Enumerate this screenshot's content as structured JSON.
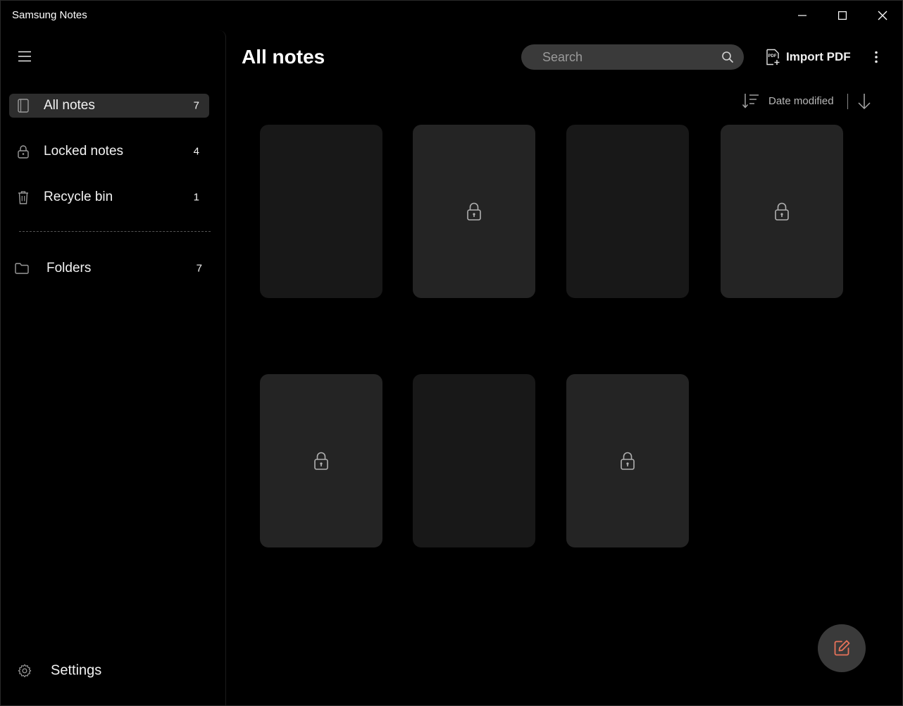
{
  "window": {
    "title": "Samsung Notes"
  },
  "sidebar": {
    "items": [
      {
        "label": "All notes",
        "count": "7",
        "icon": "notebook-icon",
        "active": true
      },
      {
        "label": "Locked notes",
        "count": "4",
        "icon": "lock-icon"
      },
      {
        "label": "Recycle bin",
        "count": "1",
        "icon": "trash-icon"
      }
    ],
    "folders": {
      "label": "Folders",
      "count": "7",
      "icon": "folder-icon"
    },
    "settings": {
      "label": "Settings",
      "icon": "gear-icon"
    }
  },
  "main": {
    "title": "All notes",
    "search": {
      "placeholder": "Search",
      "value": ""
    },
    "import_pdf_label": "Import PDF",
    "sort": {
      "label": "Date modified",
      "direction": "descending"
    },
    "notes": [
      {
        "locked": false
      },
      {
        "locked": true
      },
      {
        "locked": false
      },
      {
        "locked": true
      },
      {
        "locked": true
      },
      {
        "locked": false
      },
      {
        "locked": true
      }
    ]
  },
  "colors": {
    "accent": "#e8735a",
    "background": "#000000",
    "card_locked": "#242424",
    "card_plain": "#181818",
    "active_item": "#2d2d2d"
  }
}
